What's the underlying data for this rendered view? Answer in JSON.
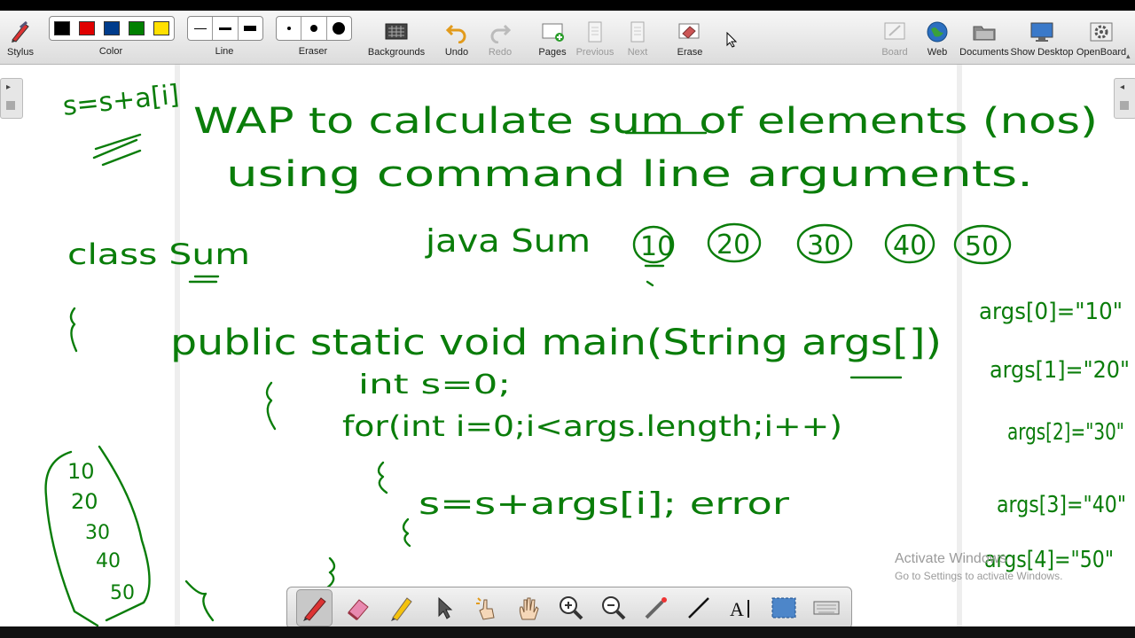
{
  "toolbar": {
    "stylus": "Stylus",
    "color": "Color",
    "line": "Line",
    "eraser": "Eraser",
    "backgrounds": "Backgrounds",
    "undo": "Undo",
    "redo": "Redo",
    "pages": "Pages",
    "previous": "Previous",
    "next": "Next",
    "erase": "Erase",
    "board": "Board",
    "web": "Web",
    "documents": "Documents",
    "show_desktop": "Show Desktop",
    "openboard": "OpenBoard"
  },
  "colors": {
    "palette": [
      "#000000",
      "#e00000",
      "#003c8c",
      "#008000",
      "#ffe000"
    ],
    "ink": "#0a7d0a"
  },
  "board_notes": {
    "l1": "s=s+a[i]",
    "l2": "WAP to calculate sum of elements (nos)",
    "l3": "using command line arguments.",
    "l4": "class Sum",
    "l5": "java Sum",
    "n10": "10",
    "n20": "20",
    "n30": "30",
    "n40": "40",
    "n50": "50",
    "l6": "public static void main(String args[])",
    "l7": "int s=0;",
    "l8": "for(int i=0;i<args.length;i++)",
    "l9": "s=s+args[i]; error",
    "a0": "args[0]=\"10\"",
    "a1": "args[1]=\"20\"",
    "a2": "args[2]=\"30\"",
    "a3": "args[3]=\"40\"",
    "a4": "args[4]=\"50\"",
    "list": [
      "10",
      "20",
      "30",
      "40",
      "50"
    ]
  },
  "watermark": {
    "title": "Activate Windows",
    "subtitle": "Go to Settings to activate Windows."
  }
}
